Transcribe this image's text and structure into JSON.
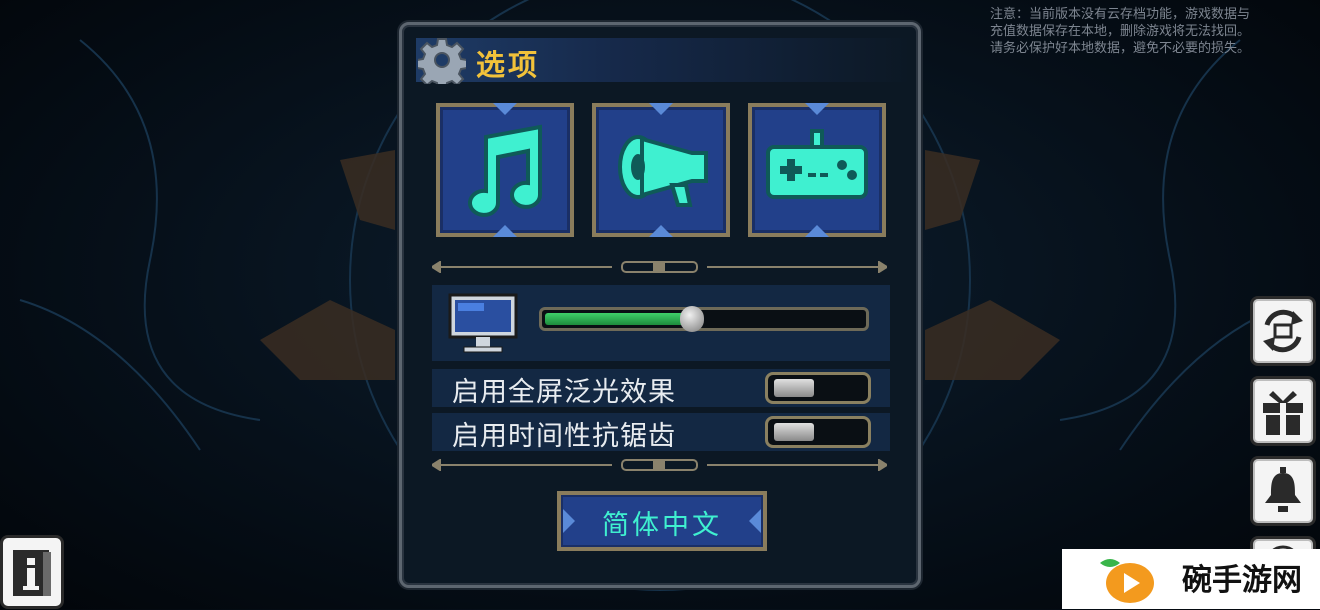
{
  "notice": "注意：当前版本没有云存档功能，游戏数据与\n充值数据保存在本地，删除游戏将无法找回。\n请务必保护好本地数据，避免不必要的损失。",
  "panel": {
    "title": "选项",
    "title_icon": "gear-icon",
    "tabs": [
      {
        "name": "music",
        "icon": "music-note-icon"
      },
      {
        "name": "sound",
        "icon": "megaphone-icon"
      },
      {
        "name": "controls",
        "icon": "gamepad-icon"
      }
    ],
    "display": {
      "icon": "monitor-icon",
      "brightness": 0.46
    },
    "options": [
      {
        "label": "启用全屏泛光效果",
        "enabled": false
      },
      {
        "label": "启用时间性抗锯齿",
        "enabled": false
      }
    ],
    "language_button": "简体中文"
  },
  "side_buttons": [
    {
      "icon": "refresh-icon"
    },
    {
      "icon": "gift-box-icon"
    },
    {
      "icon": "bell-icon"
    },
    {
      "icon": "fingerprint-icon"
    }
  ],
  "info_button": {
    "icon": "info-book-icon"
  },
  "watermark": {
    "text": "碗手游网",
    "logo": "play-logo-icon"
  },
  "colors": {
    "accent_title": "#f2c23a",
    "tab_bg": "#22408a",
    "icon_cyan": "#3ff0d0",
    "slider_fill": "#2fb957"
  }
}
